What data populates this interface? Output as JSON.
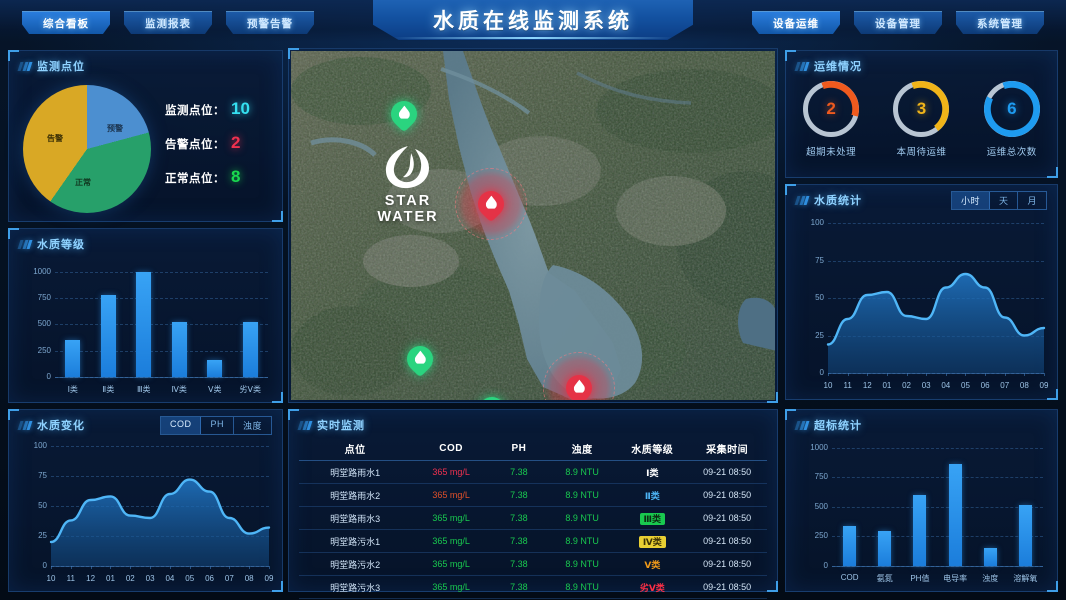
{
  "header": {
    "title": "水质在线监测系统",
    "nav_left": [
      {
        "label": "综合看板",
        "active": true
      },
      {
        "label": "监测报表",
        "active": false
      },
      {
        "label": "预警告警",
        "active": false
      }
    ],
    "nav_right": [
      {
        "label": "设备运维",
        "active": true
      },
      {
        "label": "设备管理",
        "active": false
      },
      {
        "label": "系统管理",
        "active": false
      }
    ]
  },
  "panels": {
    "points_title": "监测点位",
    "grade_title": "水质等级",
    "change_title": "水质变化",
    "realtime_title": "实时监测",
    "ops_title": "运维情况",
    "wstat_title": "水质统计",
    "over_title": "超标统计"
  },
  "points": {
    "stats": [
      {
        "key": "监测点位：",
        "value": "10",
        "color": "#35e0f0"
      },
      {
        "key": "告警点位：",
        "value": "2",
        "color": "#f0314f"
      },
      {
        "key": "正常点位：",
        "value": "8",
        "color": "#19d94f"
      }
    ],
    "pie_labels": {
      "warn": "预警",
      "normal": "正常",
      "alarm": "告警"
    }
  },
  "change_tabs": [
    {
      "label": "COD",
      "active": true
    },
    {
      "label": "PH",
      "active": false
    },
    {
      "label": "浊度",
      "active": false
    }
  ],
  "wstat_tabs": [
    {
      "label": "小时",
      "active": true
    },
    {
      "label": "天",
      "active": false
    },
    {
      "label": "月",
      "active": false
    }
  ],
  "map": {
    "logo_text": "STAR WATER",
    "markers": [
      {
        "status": "normal",
        "x": 113,
        "y": 82
      },
      {
        "status": "alarm",
        "x": 200,
        "y": 172
      },
      {
        "status": "normal",
        "x": 129,
        "y": 327
      },
      {
        "status": "normal",
        "x": 201,
        "y": 378
      },
      {
        "status": "alarm",
        "x": 288,
        "y": 356
      }
    ]
  },
  "ops": {
    "gauges": [
      {
        "label": "超期未处理",
        "value": "2",
        "percent": 35,
        "color": "#ef5a1e"
      },
      {
        "label": "本周待运维",
        "value": "3",
        "percent": 45,
        "color": "#f0b419"
      },
      {
        "label": "运维总次数",
        "value": "6",
        "percent": 88,
        "color": "#1e9bf0"
      }
    ]
  },
  "realtime": {
    "columns": [
      "点位",
      "COD",
      "PH",
      "浊度",
      "水质等级",
      "采集时间"
    ],
    "rows": [
      {
        "point": "明堂路雨水1",
        "cod": "365 mg/L",
        "cod_color": "#f0314f",
        "ph": "7.38",
        "turbidity": "8.9 NTU",
        "grade": "Ⅰ类",
        "grade_color": "#ffffff",
        "grade_bg": "transparent",
        "time": "09-21 08:50"
      },
      {
        "point": "明堂路雨水2",
        "cod": "365 mg/L",
        "cod_color": "#e0502a",
        "ph": "7.38",
        "turbidity": "8.9 NTU",
        "grade": "Ⅱ类",
        "grade_color": "#4db4f5",
        "grade_bg": "transparent",
        "time": "09-21 08:50"
      },
      {
        "point": "明堂路雨水3",
        "cod": "365 mg/L",
        "cod_color": "#19c94f",
        "ph": "7.38",
        "turbidity": "8.9 NTU",
        "grade": "Ⅲ类",
        "grade_color": "#0d2d12",
        "grade_bg": "#19c94f",
        "time": "09-21 08:50"
      },
      {
        "point": "明堂路污水1",
        "cod": "365 mg/L",
        "cod_color": "#19c94f",
        "ph": "7.38",
        "turbidity": "8.9 NTU",
        "grade": "Ⅳ类",
        "grade_color": "#3a3205",
        "grade_bg": "#e8cf33",
        "time": "09-21 08:50"
      },
      {
        "point": "明堂路污水2",
        "cod": "365 mg/L",
        "cod_color": "#19c94f",
        "ph": "7.38",
        "turbidity": "8.9 NTU",
        "grade": "Ⅴ类",
        "grade_color": "#f09a19",
        "grade_bg": "transparent",
        "time": "09-21 08:50"
      },
      {
        "point": "明堂路污水3",
        "cod": "365 mg/L",
        "cod_color": "#19c94f",
        "ph": "7.38",
        "turbidity": "8.9 NTU",
        "grade": "劣Ⅴ类",
        "grade_color": "#ff2f46",
        "grade_bg": "transparent",
        "time": "09-21 08:50"
      }
    ]
  },
  "chart_data": [
    {
      "id": "grade",
      "type": "bar",
      "title": "水质等级",
      "categories": [
        "Ⅰ类",
        "Ⅱ类",
        "Ⅲ类",
        "Ⅳ类",
        "Ⅴ类",
        "劣Ⅴ类"
      ],
      "values": [
        350,
        780,
        1000,
        520,
        160,
        520
      ],
      "yticks": [
        0,
        250,
        500,
        750,
        1000
      ],
      "ylim": [
        0,
        1100
      ],
      "xlabel": "",
      "ylabel": "",
      "grid": true
    },
    {
      "id": "change",
      "type": "area",
      "title": "水质变化",
      "x": [
        "10",
        "11",
        "12",
        "01",
        "02",
        "03",
        "04",
        "05",
        "06",
        "07",
        "08",
        "09"
      ],
      "values": [
        20,
        38,
        55,
        58,
        42,
        40,
        60,
        72,
        62,
        40,
        27,
        32
      ],
      "yticks": [
        0,
        25,
        50,
        75,
        100
      ],
      "ylim": [
        0,
        100
      ],
      "grid": true
    },
    {
      "id": "wstat",
      "type": "area",
      "title": "水质统计",
      "x": [
        "10",
        "11",
        "12",
        "01",
        "02",
        "03",
        "04",
        "05",
        "06",
        "07",
        "08",
        "09"
      ],
      "values": [
        19,
        36,
        52,
        54,
        38,
        36,
        57,
        66,
        57,
        37,
        25,
        30
      ],
      "yticks": [
        0,
        25,
        50,
        75,
        100
      ],
      "ylim": [
        0,
        100
      ],
      "grid": true
    },
    {
      "id": "over",
      "type": "bar",
      "title": "超标统计",
      "categories": [
        "COD",
        "氨氮",
        "PH值",
        "电导率",
        "浊度",
        "溶解氧"
      ],
      "values": [
        340,
        300,
        600,
        860,
        155,
        520
      ],
      "yticks": [
        0,
        250,
        500,
        750,
        1000
      ],
      "ylim": [
        0,
        1050
      ],
      "grid": true
    },
    {
      "id": "points_pie",
      "type": "pie",
      "title": "监测点位",
      "labels": [
        "预警",
        "正常",
        "告警"
      ],
      "values": [
        21,
        39,
        40
      ],
      "colors": [
        "#4c8fd0",
        "#27a06a",
        "#d9a825"
      ]
    }
  ]
}
